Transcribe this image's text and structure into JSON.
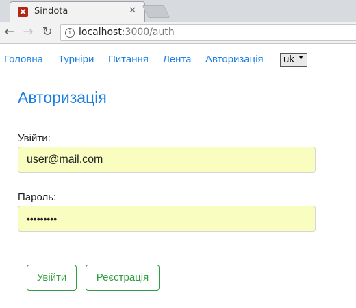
{
  "browser": {
    "tab_title": "Sindota",
    "tab_close": "✕",
    "url_host": "localhost",
    "url_rest": ":3000/auth"
  },
  "nav": {
    "items": [
      "Головна",
      "Турніри",
      "Питання",
      "Лента",
      "Авторизація"
    ],
    "lang": "uk"
  },
  "page": {
    "title": "Авторизація",
    "login_label": "Увійти:",
    "login_value": "user@mail.com",
    "password_label": "Пароль:",
    "password_value": "•••••••••",
    "submit_label": "Увійти",
    "register_label": "Реєстрація"
  },
  "colors": {
    "link": "#1a7fe3",
    "button": "#2e9e41",
    "autofill": "#fafdc0"
  }
}
